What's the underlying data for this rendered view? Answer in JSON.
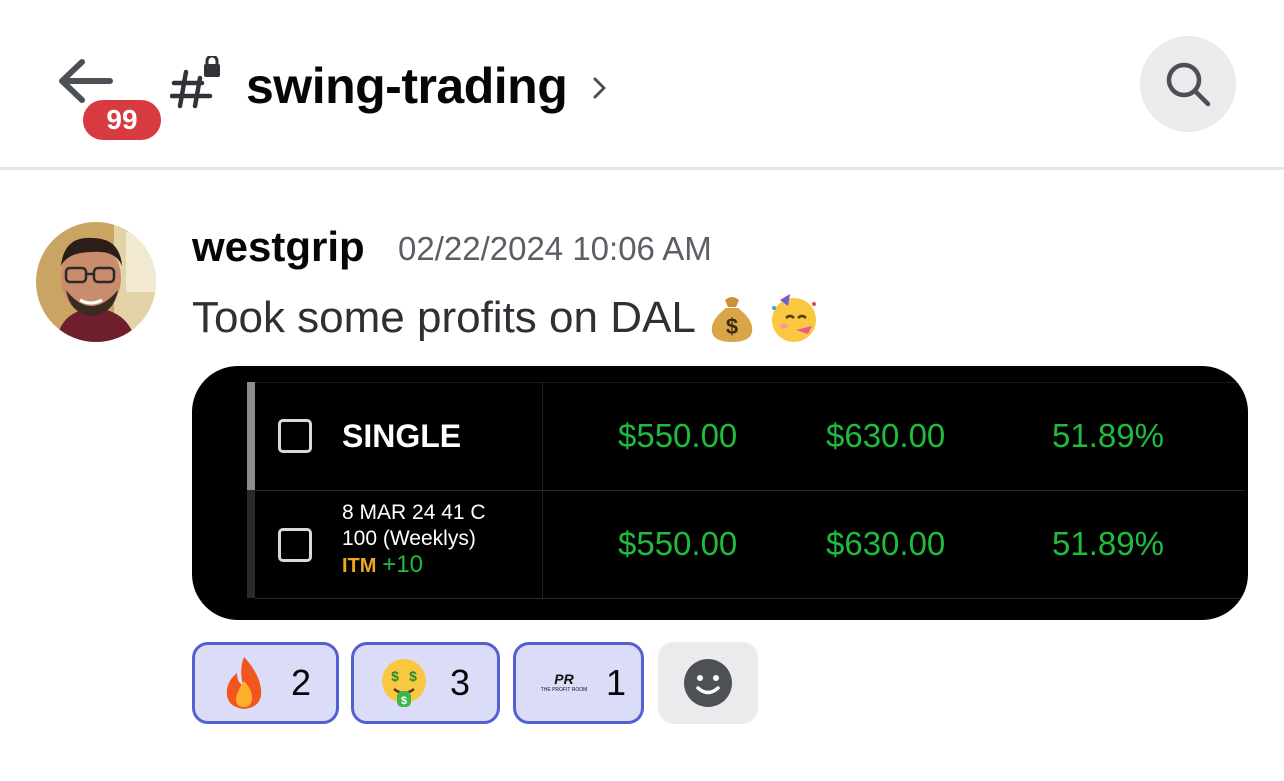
{
  "header": {
    "back_icon": "arrow-left-icon",
    "unread_badge": "99",
    "channel_icon": "locked-channel-hash-icon",
    "channel_name": "swing-trading",
    "chevron_icon": "chevron-right-icon",
    "search_icon": "search-icon"
  },
  "message": {
    "author": "westgrip",
    "timestamp": "02/22/2024 10:06 AM",
    "text": "Took some profits on DAL",
    "emojis": [
      "money-bag-icon",
      "partying-face-icon"
    ],
    "attachment": {
      "rows": [
        {
          "label": "SINGLE",
          "cost": "$550.00",
          "value": "$630.00",
          "pct": "51.89%"
        },
        {
          "contract_line1": "8 MAR 24 41 C",
          "contract_line2": "100 (Weeklys)",
          "itm": "ITM",
          "qty": "+10",
          "cost": "$550.00",
          "value": "$630.00",
          "pct": "51.89%"
        }
      ]
    }
  },
  "reactions": [
    {
      "icon": "fire-icon",
      "count": "2"
    },
    {
      "icon": "money-mouth-face-icon",
      "count": "3"
    },
    {
      "icon": "profit-room-logo-icon",
      "count": "1",
      "logo_text": "PR",
      "logo_subtext": "THE PROFIT ROOM"
    }
  ],
  "add_reaction_icon": "add-reaction-smiley-icon",
  "colors": {
    "badge": "#d83a42",
    "reaction_bg": "#dbddf8",
    "reaction_border": "#5460cf",
    "gain_green": "#1fbb3f",
    "itm_orange": "#f0a81c"
  }
}
